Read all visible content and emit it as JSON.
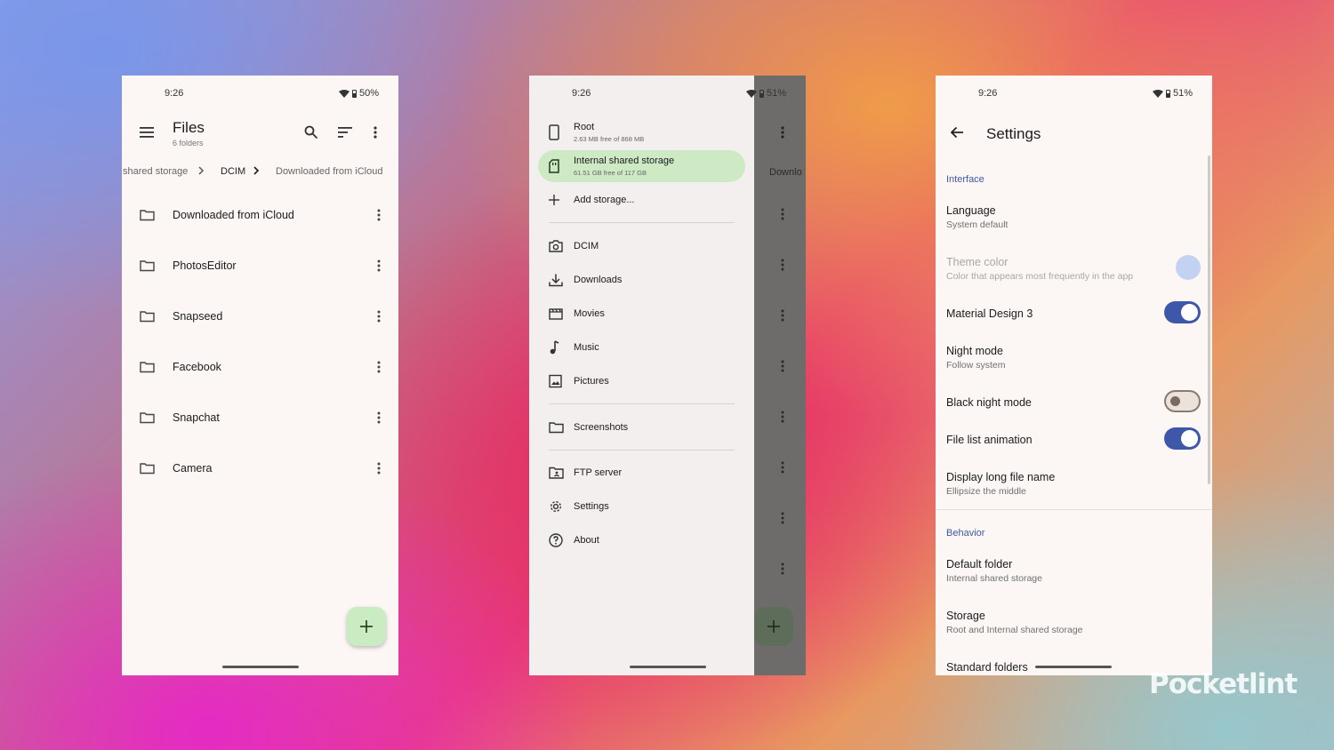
{
  "phone1": {
    "status": {
      "time": "9:26",
      "battery": "50%"
    },
    "title": "Files",
    "subtitle": "6 folders",
    "breadcrumb": [
      "shared storage",
      "DCIM",
      "Downloaded from iCloud"
    ],
    "folders": [
      {
        "name": "Downloaded from iCloud"
      },
      {
        "name": "PhotosEditor"
      },
      {
        "name": "Snapseed"
      },
      {
        "name": "Facebook"
      },
      {
        "name": "Snapchat"
      },
      {
        "name": "Camera"
      }
    ],
    "fab_icon": "plus-icon"
  },
  "phone2": {
    "status": {
      "time": "9:26",
      "battery": "51%"
    },
    "storage": [
      {
        "label": "Root",
        "sub": "2.63 MB free of 868 MB"
      },
      {
        "label": "Internal shared storage",
        "sub": "61.51 GB free of 117 GB"
      }
    ],
    "add_storage": "Add storage...",
    "standard": [
      "DCIM",
      "Downloads",
      "Movies",
      "Music",
      "Pictures"
    ],
    "custom": [
      "Screenshots"
    ],
    "other": [
      "FTP server",
      "Settings",
      "About"
    ],
    "behind_text": "Downlo"
  },
  "phone3": {
    "status": {
      "time": "9:26",
      "battery": "51%"
    },
    "title": "Settings",
    "interface_header": "Interface",
    "language": {
      "title": "Language",
      "sub": "System default"
    },
    "theme": {
      "title": "Theme color",
      "sub": "Color that appears most frequently in the app",
      "swatch": "#c3d1f3"
    },
    "md3": {
      "title": "Material Design 3",
      "on": true
    },
    "night": {
      "title": "Night mode",
      "sub": "Follow system"
    },
    "black_night": {
      "title": "Black night mode",
      "on": false
    },
    "file_anim": {
      "title": "File list animation",
      "on": true
    },
    "long_name": {
      "title": "Display long file name",
      "sub": "Ellipsize the middle"
    },
    "behavior_header": "Behavior",
    "default_folder": {
      "title": "Default folder",
      "sub": "Internal shared storage"
    },
    "storage": {
      "title": "Storage",
      "sub": "Root and Internal shared storage"
    },
    "standard_folders": {
      "title": "Standard folders"
    }
  },
  "watermark": "Pocketlint",
  "colors": {
    "accent": "#3e57a8",
    "fab": "#c9ecc3",
    "selected": "#cdeac5"
  }
}
